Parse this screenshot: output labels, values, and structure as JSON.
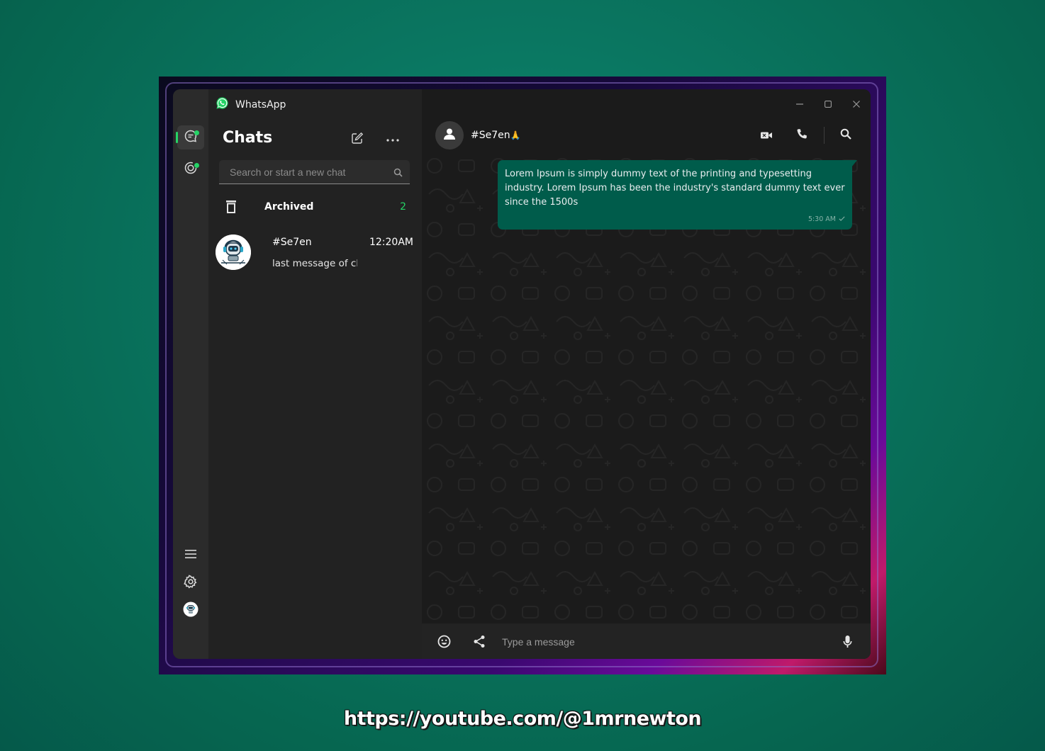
{
  "app": {
    "title": "WhatsApp",
    "accent": "#25d366",
    "bubble_color": "#005c4b"
  },
  "sidebar": {
    "items": [
      {
        "icon": "chat-icon",
        "active": true
      },
      {
        "icon": "status-icon",
        "active": false
      }
    ],
    "bottom": [
      {
        "icon": "hamburger-menu-icon"
      },
      {
        "icon": "settings-icon"
      },
      {
        "icon": "profile-avatar-icon"
      }
    ]
  },
  "chat_list": {
    "heading": "Chats",
    "search_placeholder": "Search or start a new chat",
    "archived": {
      "label": "Archived",
      "count": "2"
    },
    "chats": [
      {
        "name": "#Se7en",
        "time": "12:20AM",
        "preview": "last message of ch"
      }
    ]
  },
  "conversation": {
    "contact_name": "#Se7en",
    "contact_emoji": "🙏",
    "messages": [
      {
        "text": "Lorem  Ipsum is simply dummy text of the printing and typesetting industry. Lorem Ipsum has been the industry's standard dummy text ever since the 1500s",
        "time": "5:30 AM",
        "outgoing": true
      }
    ],
    "composer_placeholder": "Type a message"
  },
  "footer": {
    "url": "https://youtube.com/@1mrnewton"
  }
}
